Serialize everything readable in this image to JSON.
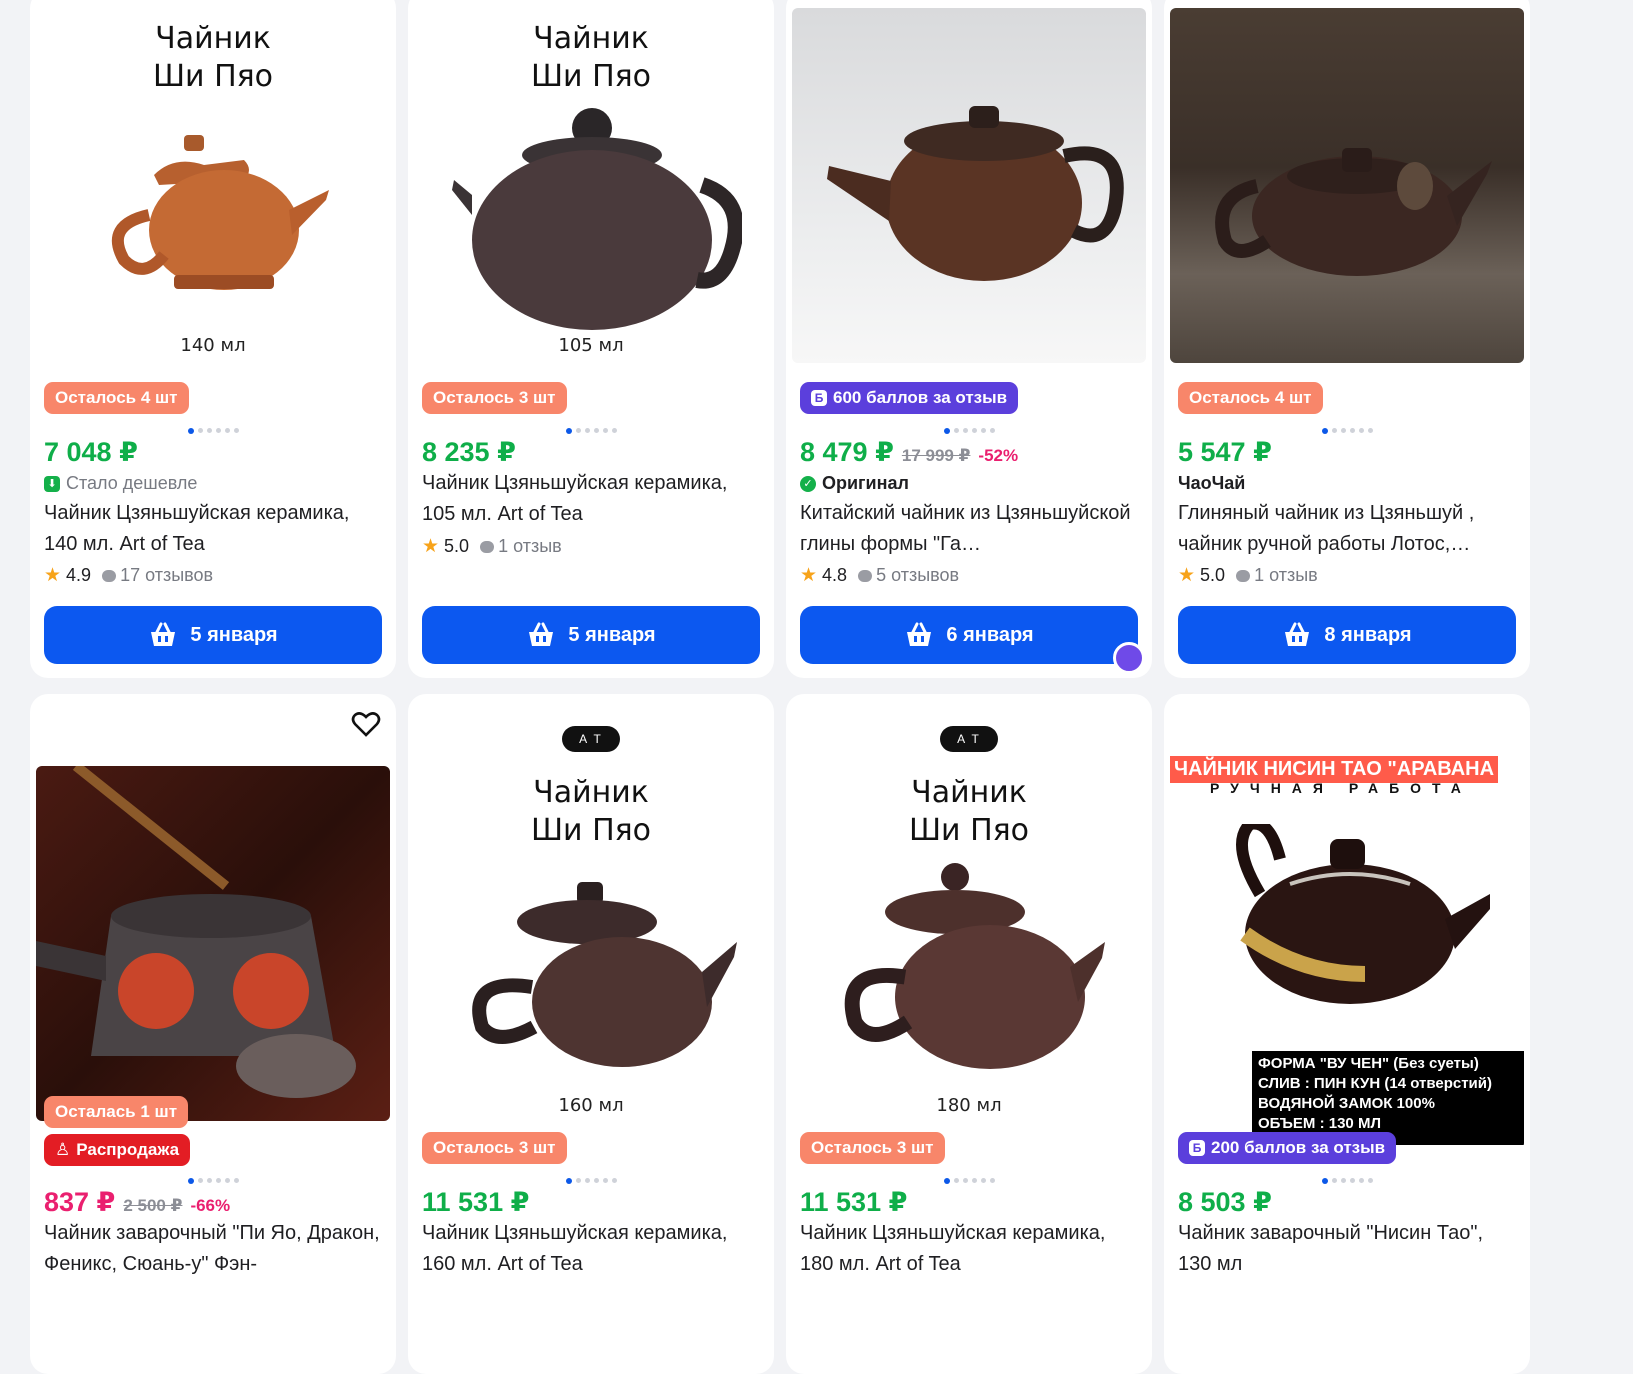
{
  "cards": [
    {
      "image": {
        "title_line1": "Чайник",
        "title_line2": "Ши Пяо",
        "volume": "140 мл"
      },
      "badge": "Осталось 4 шт",
      "price": "7 048 ₽",
      "subtitle": "Стало дешевле",
      "title": "Чайник Цзяньшуйская керамика, 140 мл. Art of Tea",
      "rating": "4.9",
      "reviews": "17 отзывов",
      "button": "5 января"
    },
    {
      "image": {
        "title_line1": "Чайник",
        "title_line2": "Ши Пяо",
        "volume": "105 мл"
      },
      "badge": "Осталось 3 шт",
      "price": "8 235 ₽",
      "title": "Чайник Цзяньшуйская керамика, 105 мл. Art of Tea",
      "rating": "5.0",
      "reviews": "1 отзыв",
      "button": "5 января"
    },
    {
      "badge": "600 баллов за отзыв",
      "price": "8 479 ₽",
      "old_price": "17 999 ₽",
      "discount": "-52%",
      "subtitle": "Оригинал",
      "title": "Китайский чайник из Цзяньшуйской глины формы \"Га…",
      "rating": "4.8",
      "reviews": "5 отзывов",
      "button": "6 января"
    },
    {
      "badge": "Осталось 4 шт",
      "price": "5 547 ₽",
      "subtitle": "ЧаоЧай",
      "title": "Глиняный чайник из Цзяньшуй , чайник ручной работы Лотос,…",
      "rating": "5.0",
      "reviews": "1 отзыв",
      "button": "8 января"
    },
    {
      "badge": "Осталась 1 шт",
      "badge2": "Распродажа",
      "price": "837 ₽",
      "old_price": "2 500 ₽",
      "discount": "-66%",
      "title": "Чайник заварочный \"Пи Яо, Дракон, Феникс, Сюань-у\" Фэн-"
    },
    {
      "image": {
        "logo": "A T",
        "title_line1": "Чайник",
        "title_line2": "Ши Пяо",
        "volume": "160 мл"
      },
      "badge": "Осталось 3 шт",
      "price": "11 531 ₽",
      "title": "Чайник Цзяньшуйская керамика, 160 мл. Art of Tea"
    },
    {
      "image": {
        "logo": "A T",
        "title_line1": "Чайник",
        "title_line2": "Ши Пяо",
        "volume": "180 мл"
      },
      "badge": "Осталось 3 шт",
      "price": "11 531 ₽",
      "title": "Чайник Цзяньшуйская керамика, 180 мл. Art of Tea"
    },
    {
      "image": {
        "banner": "ЧАЙНИК НИСИН ТАО \"АРАВАНА",
        "banner_sub": "РУЧНАЯ РАБОТА",
        "info": [
          "ФОРМА \"ВУ ЧЕН\" (Без суеты)",
          "СЛИВ : ПИН КУН (14 отверстий)",
          "ВОДЯНОЙ ЗАМОК 100%",
          "ОБЪЕМ : 130 МЛ"
        ]
      },
      "badge": "200 баллов за отзыв",
      "price": "8 503 ₽",
      "title": "Чайник заварочный \"Нисин Тао\", 130 мл"
    }
  ]
}
